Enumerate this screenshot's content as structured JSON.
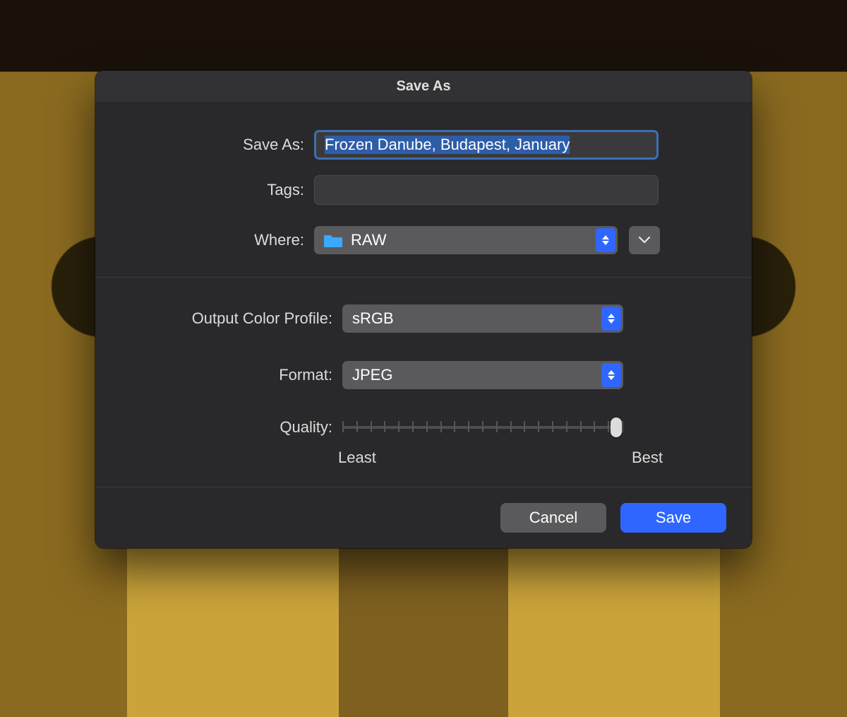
{
  "dialog": {
    "title": "Save As",
    "labels": {
      "save_as": "Save As:",
      "tags": "Tags:",
      "where": "Where:",
      "output_color_profile": "Output Color Profile:",
      "format": "Format:",
      "quality": "Quality:"
    },
    "filename_value": "Frozen Danube, Budapest, January",
    "tags_value": "",
    "where": {
      "folder_name": "RAW"
    },
    "output_color_profile_value": "sRGB",
    "format_value": "JPEG",
    "quality": {
      "ticks": 21,
      "value_fraction": 0.975,
      "min_label": "Least",
      "max_label": "Best"
    },
    "buttons": {
      "cancel": "Cancel",
      "save": "Save"
    }
  }
}
